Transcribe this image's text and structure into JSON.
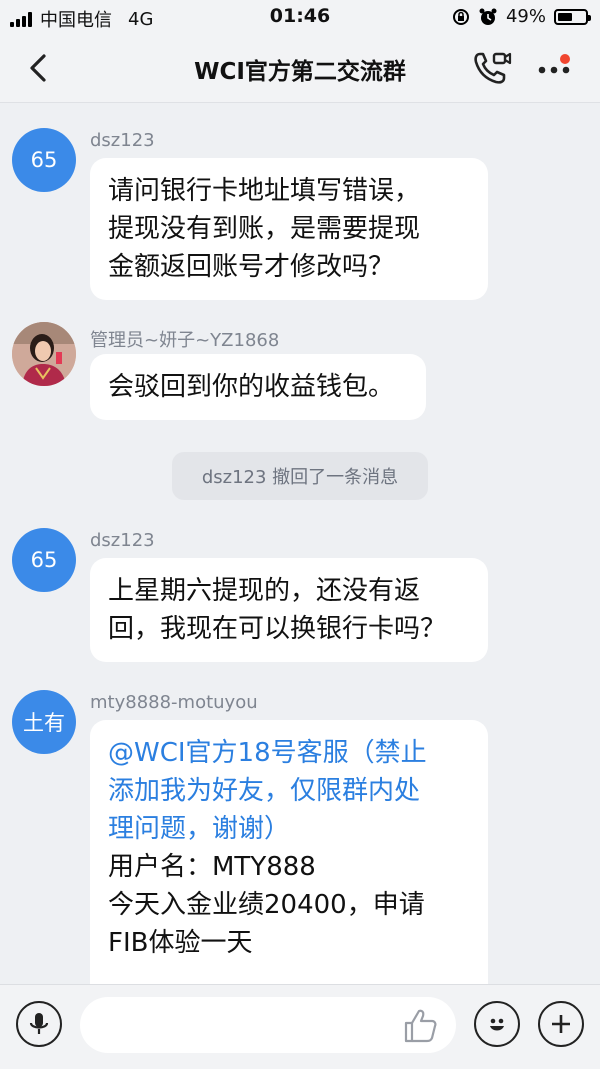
{
  "status_bar": {
    "carrier": "中国电信",
    "network": "4G",
    "time": "01:46",
    "battery": "49%"
  },
  "header": {
    "title": "WCI官方第二交流群",
    "icons": [
      "back-icon",
      "video-call-icon",
      "more-icon"
    ]
  },
  "messages": [
    {
      "avatar_text": "65",
      "sender": "dsz123",
      "lines": [
        "请问银行卡地址填写错误，",
        "提现没有到账，是需要提现",
        "金额返回账号才修改吗？"
      ]
    },
    {
      "avatar_text": "",
      "sender": "管理员~妍子~YZ1868",
      "lines": [
        "会驳回到你的收益钱包。"
      ]
    },
    {
      "avatar_text": "65",
      "sender": "dsz123",
      "lines": [
        "上星期六提现的，还没有返",
        "回，我现在可以换银行卡吗？"
      ]
    },
    {
      "avatar_text": "土有",
      "sender": "mty8888-motuyou",
      "mention_lines": [
        "@WCI官方18号客服（禁止",
        "添加我为好友，仅限群内处",
        "理问题，谢谢）"
      ],
      "lines": [
        "用户名：MTY888",
        "今天入金业绩20400，申请",
        "FIB体验一天"
      ]
    }
  ],
  "system_notice": "dsz123 撤回了一条消息",
  "input_bar": {
    "placeholder": "",
    "icons": [
      "microphone-icon",
      "thumbs-up-icon",
      "emoji-icon",
      "plus-icon"
    ]
  },
  "colors": {
    "accent": "#3b8ae8",
    "link": "#2b7fe0",
    "background": "#eef0f3",
    "notification_dot": "#f0452f"
  }
}
